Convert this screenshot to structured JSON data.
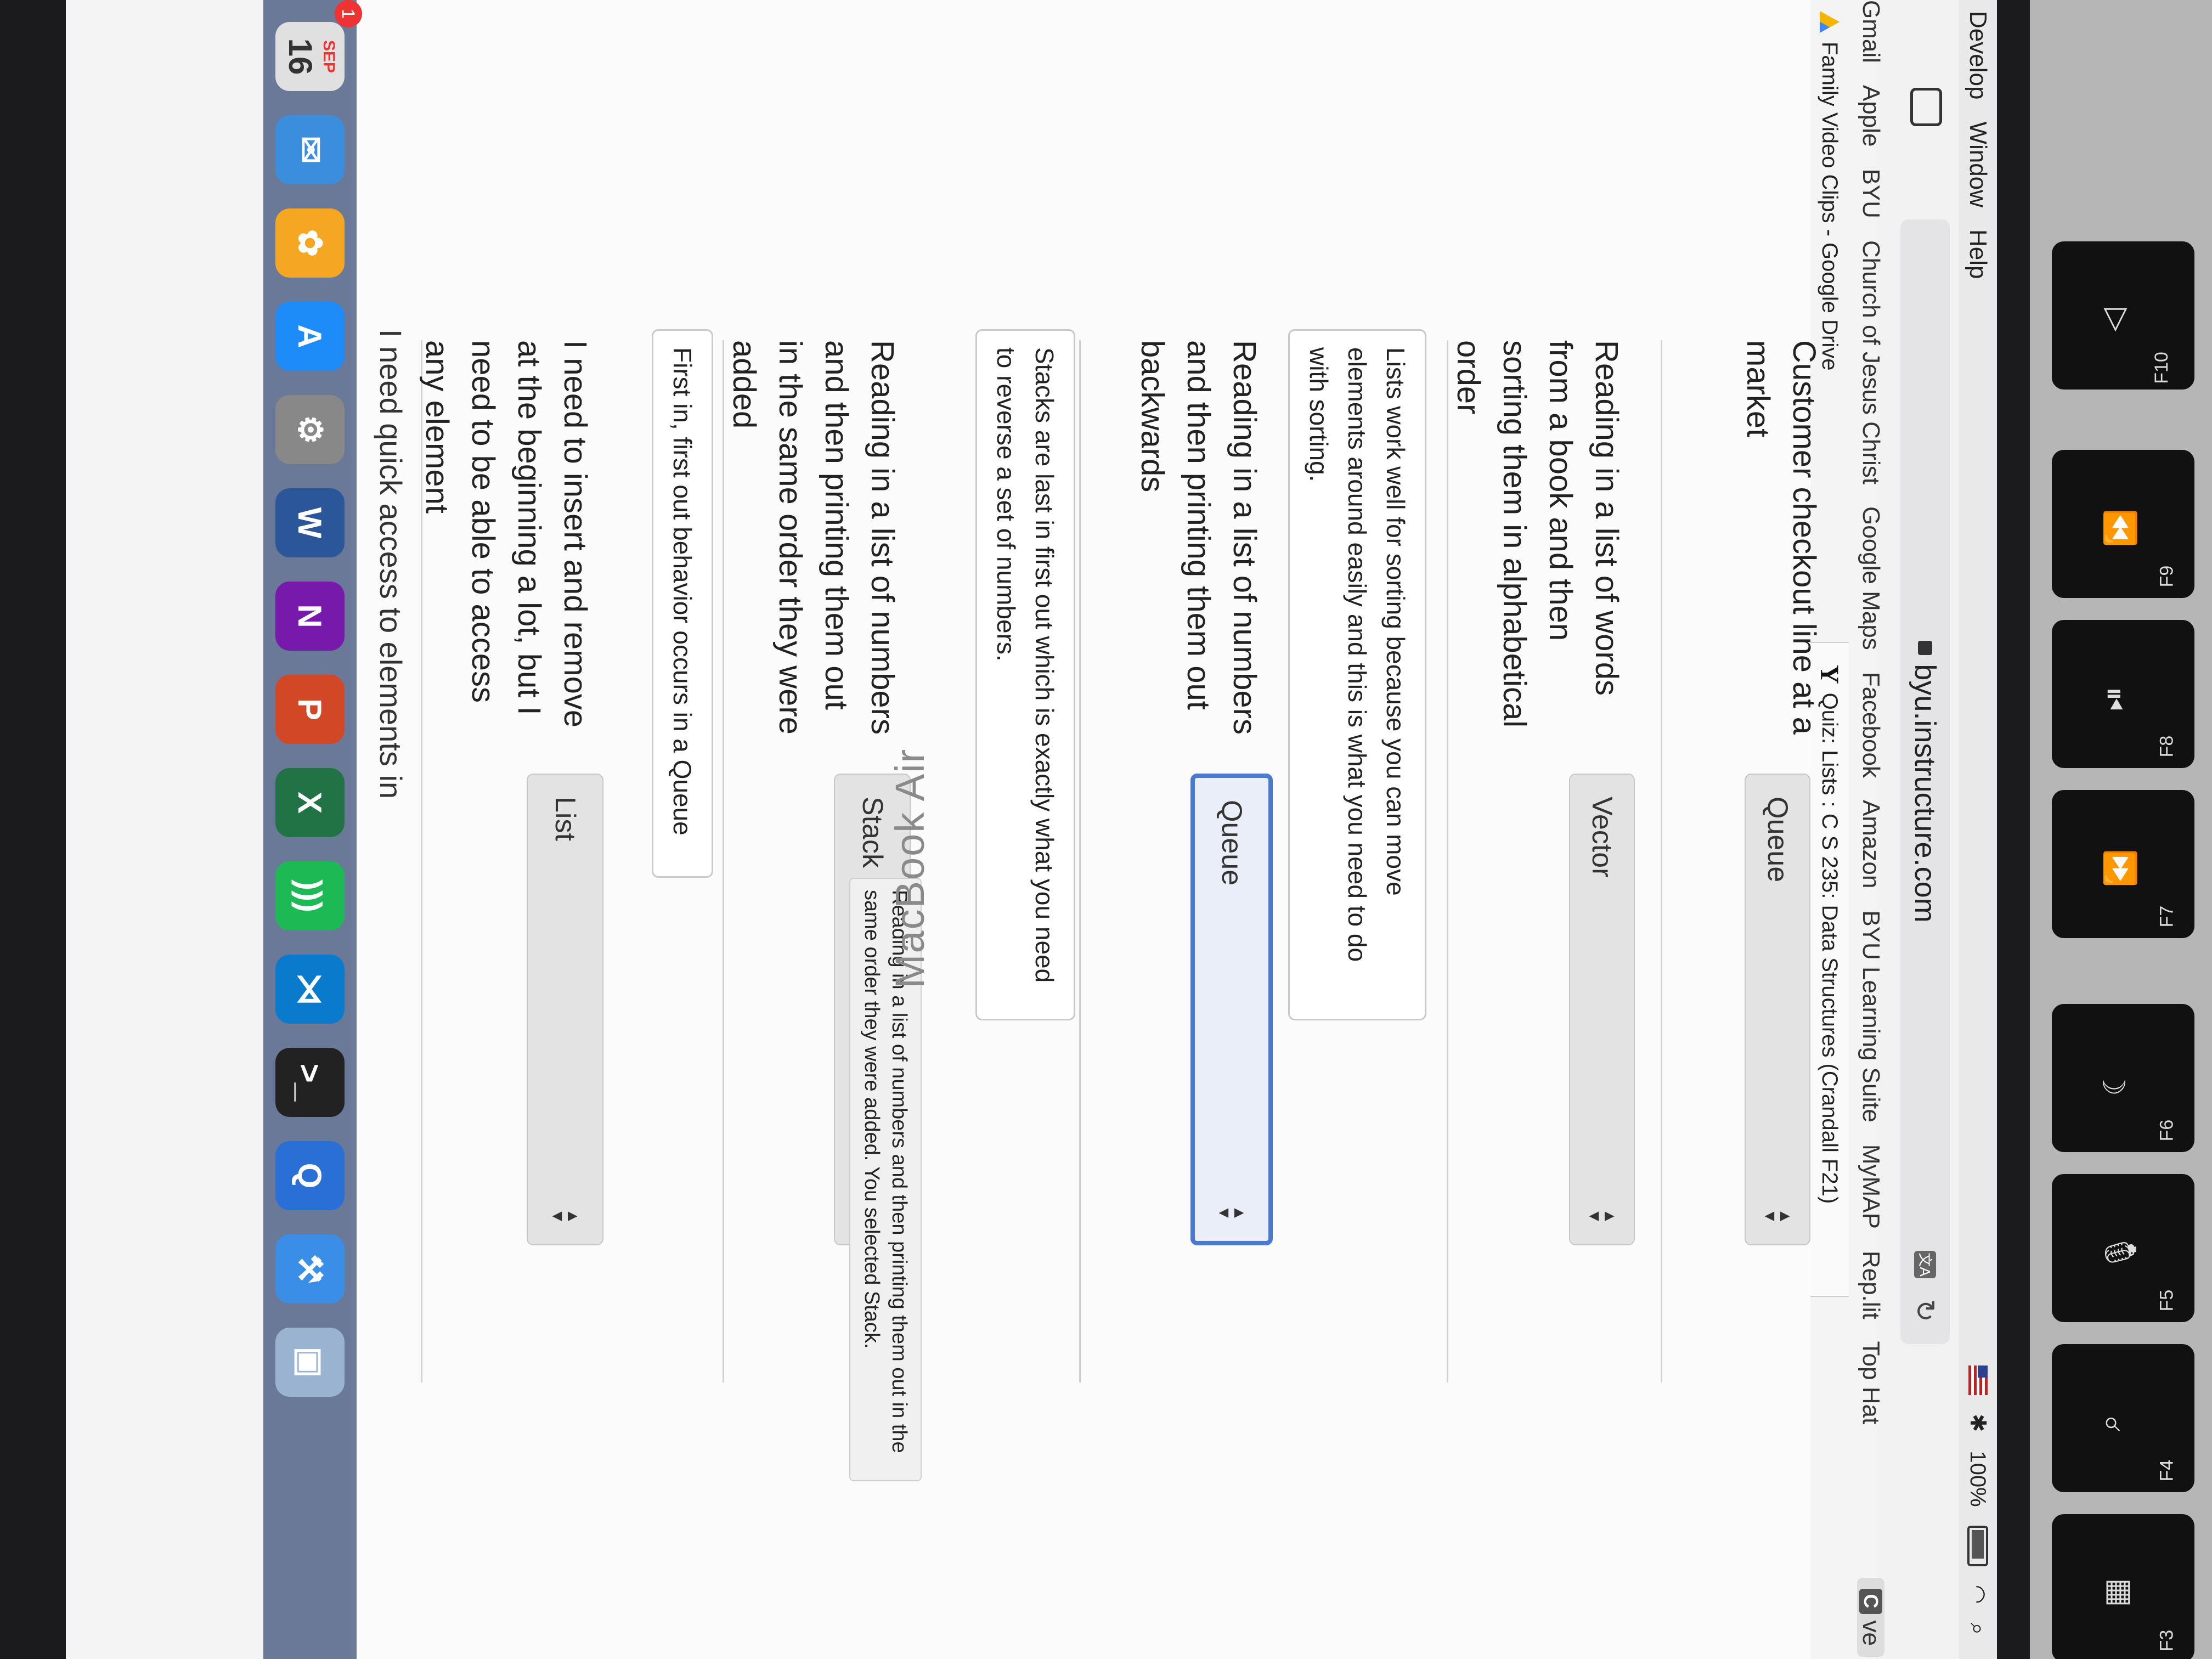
{
  "menubar": {
    "items": [
      "Develop",
      "Window",
      "Help"
    ],
    "battery": "100%"
  },
  "browser": {
    "url": "byu.instructure.com",
    "bookmarks": [
      "Gmail",
      "Apple",
      "BYU",
      "Church of Jesus Christ",
      "Google Maps",
      "Facebook",
      "Amazon",
      "BYU Learning Suite",
      "MyMAP",
      "Rep.lit",
      "Top Hat"
    ],
    "bookmark_pill": "ve",
    "bookmark_pill_badge": "C",
    "tabs": [
      {
        "label": "Family Video Clips - Google Drive"
      },
      {
        "label": "Quiz: Lists : C S 235: Data Structures (Crandall F21)"
      }
    ]
  },
  "quiz": {
    "questions": [
      {
        "text": "Customer checkout line at a market",
        "answer": "Queue"
      },
      {
        "text": "Reading in a list of words from a book and then sorting them in alphabetical order",
        "answer": "Vector",
        "feedback": "Lists work well for sorting because you can move elements around easily and this is what you need to do with sorting."
      },
      {
        "text": "Reading in a list of numbers and then printing them out backwards",
        "answer": "Queue",
        "feedback": "Stacks are last in first out which is exactly what you need to reverse a set of numbers."
      },
      {
        "text": "Reading in a list of numbers and then printing them out in the same order they were added",
        "answer": "Stack",
        "feedback": "First in, first out behavior occurs in a Queue"
      },
      {
        "text": "I need to insert and remove at the beginning a lot, but I need to be able to access any element",
        "answer": "List"
      }
    ],
    "tooltip": "Reading in a list of numbers and then printing them out in the same order they were added. You selected Stack.",
    "next_partial": "I need quick access to elements in"
  },
  "dock": {
    "calendar_month": "SEP",
    "calendar_day": "16",
    "badge": "1",
    "apps": [
      {
        "name": "mail",
        "color": "#3b8ddd",
        "glyph": "✉"
      },
      {
        "name": "photos",
        "color": "#f5a623",
        "glyph": "✿"
      },
      {
        "name": "appstore",
        "color": "#1d8cf8",
        "glyph": "A"
      },
      {
        "name": "settings",
        "color": "#888888",
        "glyph": "⚙"
      },
      {
        "name": "word",
        "color": "#2b579a",
        "glyph": "W"
      },
      {
        "name": "onenote",
        "color": "#7719aa",
        "glyph": "N"
      },
      {
        "name": "powerpoint",
        "color": "#d24726",
        "glyph": "P"
      },
      {
        "name": "excel",
        "color": "#217346",
        "glyph": "X"
      },
      {
        "name": "spotify",
        "color": "#1db954",
        "glyph": ")))"
      },
      {
        "name": "vscode",
        "color": "#0a7acc",
        "glyph": "⋊"
      },
      {
        "name": "terminal",
        "color": "#222222",
        "glyph": ">_"
      },
      {
        "name": "quicktime",
        "color": "#2a6fd6",
        "glyph": "Q"
      },
      {
        "name": "xcode",
        "color": "#3a8ee6",
        "glyph": "⚒"
      },
      {
        "name": "preview",
        "color": "#9ab3d1",
        "glyph": "▣"
      }
    ]
  },
  "device": {
    "label": "MacBook Air",
    "function_keys": [
      "F3",
      "F4",
      "F5",
      "F6",
      "F7",
      "F8",
      "F9",
      "F10"
    ]
  }
}
